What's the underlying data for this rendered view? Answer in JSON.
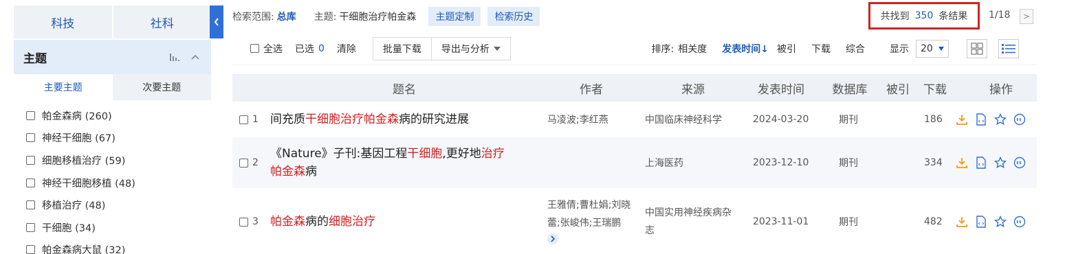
{
  "sidebar": {
    "cat_tabs": [
      "科技",
      "社科"
    ],
    "topic_title": "主题",
    "sub_tabs": [
      "主要主题",
      "次要主题"
    ],
    "topics": [
      "帕金森病 (260)",
      "神经干细胞 (67)",
      "细胞移植治疗 (59)",
      "神经干细胞移植 (48)",
      "移植治疗 (48)",
      "干细胞 (34)",
      "帕金森病大鼠 (32)"
    ]
  },
  "search": {
    "scope_label": "检索范围:",
    "scope_value": "总库",
    "theme_label": "主题:",
    "theme_value": "干细胞治疗帕金森",
    "btn_custom": "主题定制",
    "btn_history": "检索历史",
    "found_prefix": "共找到",
    "found_count": "350",
    "found_suffix": "条结果",
    "page": "1/18",
    "next": ">"
  },
  "toolbar": {
    "select_all": "全选",
    "selected_label": "已选",
    "selected_count": "0",
    "clear": "清除",
    "batch_download": "批量下载",
    "export": "导出与分析",
    "sort_label": "排序:",
    "sort_relevance": "相关度",
    "sort_date": "发表时间",
    "sort_cited": "被引",
    "sort_download": "下载",
    "sort_composite": "综合",
    "display_label": "显示",
    "display_value": "20"
  },
  "table": {
    "headers": [
      "题名",
      "作者",
      "来源",
      "发表时间",
      "数据库",
      "被引",
      "下载",
      "操作"
    ],
    "rows": [
      {
        "index": "1",
        "title_parts": [
          {
            "t": "间充质",
            "h": false
          },
          {
            "t": "干细胞治疗帕金森",
            "h": true
          },
          {
            "t": "病的研究进展",
            "h": false
          }
        ],
        "author": "马凌波;李红燕",
        "source": "中国临床神经科学",
        "date": "2024-03-20",
        "db": "期刊",
        "cited": "",
        "downloads": "186"
      },
      {
        "index": "2",
        "title_line1": [
          {
            "t": "《Nature》子刊:基因工程",
            "h": false
          },
          {
            "t": "干细胞",
            "h": true
          },
          {
            "t": ",更好地",
            "h": false
          },
          {
            "t": "治疗",
            "h": true
          }
        ],
        "title_line2": [
          {
            "t": "帕金森",
            "h": true
          },
          {
            "t": "病",
            "h": false
          }
        ],
        "author": "",
        "source": "上海医药",
        "date": "2023-12-10",
        "db": "期刊",
        "cited": "",
        "downloads": "334"
      },
      {
        "index": "3",
        "title_parts": [
          {
            "t": "帕金森",
            "h": true
          },
          {
            "t": "病的",
            "h": false
          },
          {
            "t": "细胞治疗",
            "h": true
          }
        ],
        "author_line1": "王雅倩;曹杜娟;刘晓",
        "author_line2": "蕾;张峻伟;王瑞鹏",
        "source_line1": "中国实用神经疾病杂",
        "source_line2": "志",
        "date": "2023-11-01",
        "db": "期刊",
        "cited": "",
        "downloads": "482"
      }
    ]
  },
  "colors": {
    "accent": "#1e5bb8",
    "highlight": "#d32020",
    "download_icon": "#f39c12",
    "header_bg": "#eef1f5"
  }
}
